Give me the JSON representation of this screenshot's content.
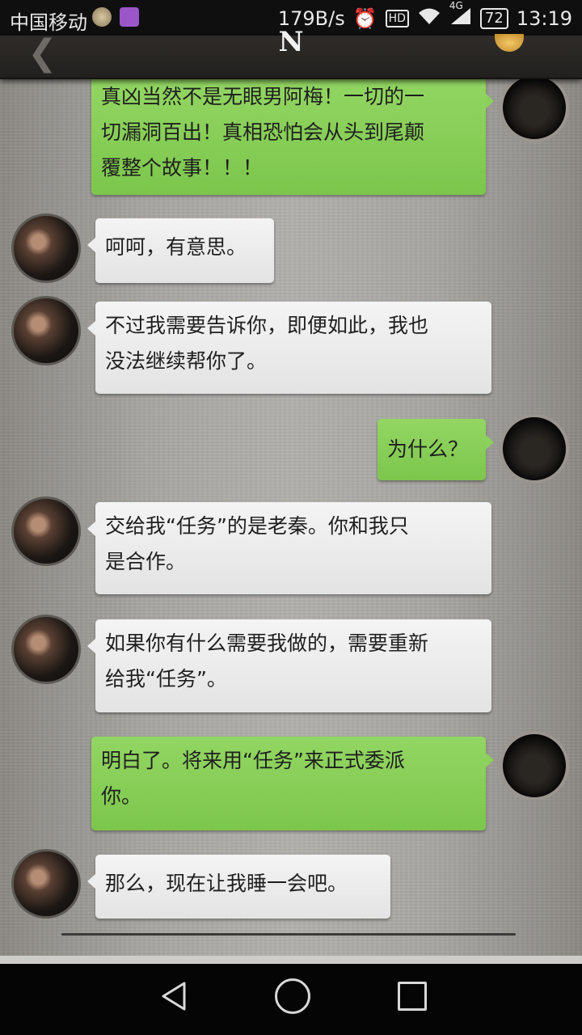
{
  "status_bar": {
    "carrier": "中国移动",
    "speed": "179B/s",
    "hd": "HD",
    "network": "4G",
    "battery": "72",
    "time": "13:19"
  },
  "header": {
    "title": "N",
    "back_icon": "chevron-left-icon",
    "coin_icon": "gold-coin-icon"
  },
  "messages": [
    {
      "side": "right",
      "lines": [
        "真凶当然不是无眼男阿梅！一切的一",
        "切漏洞百出！真相恐怕会从头到尾颠",
        "覆整个故事！！！"
      ]
    },
    {
      "side": "left",
      "lines": [
        "呵呵，有意思。"
      ]
    },
    {
      "side": "left",
      "lines": [
        "不过我需要告诉你，即便如此，我也",
        "没法继续帮你了。"
      ]
    },
    {
      "side": "right",
      "lines": [
        "为什么？"
      ]
    },
    {
      "side": "left",
      "lines": [
        "交给我“任务”的是老秦。你和我只",
        "是合作。"
      ]
    },
    {
      "side": "left",
      "lines": [
        "如果你有什么需要我做的，需要重新",
        "给我“任务”。"
      ]
    },
    {
      "side": "right",
      "lines": [
        "明白了。将来用“任务”来正式委派",
        "你。"
      ]
    },
    {
      "side": "left",
      "lines": [
        "那么，现在让我睡一会吧。"
      ]
    }
  ],
  "nav": {
    "back_icon": "triangle-back-icon",
    "home_icon": "circle-home-icon",
    "recent_icon": "square-recents-icon"
  },
  "colors": {
    "right_bubble": "#86cf55",
    "left_bubble": "#ececec",
    "header": "#2a2826"
  }
}
